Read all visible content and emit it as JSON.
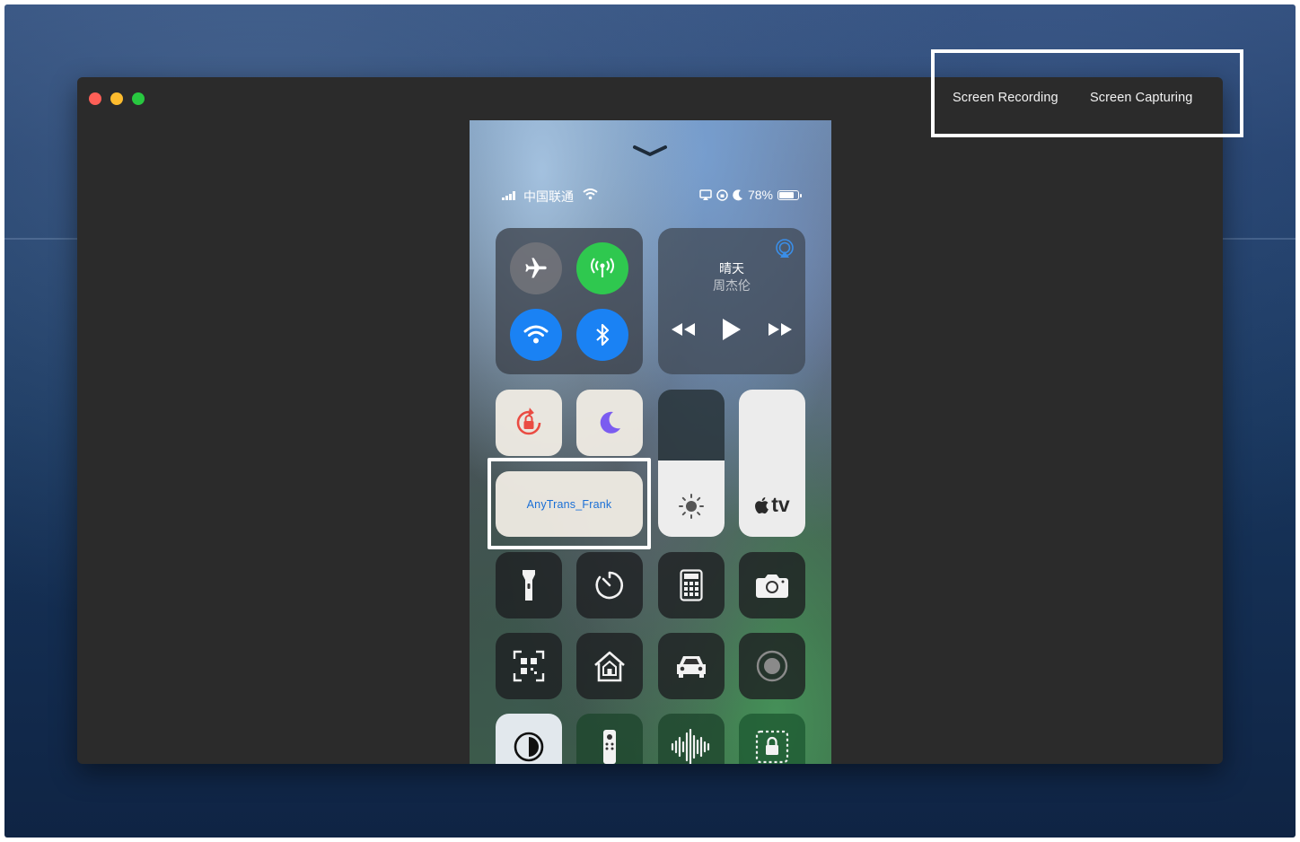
{
  "window": {
    "controls": [
      "close",
      "minimize",
      "maximize"
    ]
  },
  "mode_tabs": {
    "recording": "Screen Recording",
    "capturing": "Screen Capturing"
  },
  "phone": {
    "status": {
      "carrier": "中国联通",
      "battery": "78%"
    },
    "music": {
      "title": "晴天",
      "artist": "周杰伦"
    },
    "screen_mirroring": {
      "label": "AnyTrans_Frank"
    },
    "apple_tv": {
      "label": "tv"
    },
    "brightness_level": 0.52,
    "colors": {
      "green": "#2fc84f",
      "blue": "#1a82f4",
      "mirror_text": "#1a6fd6"
    },
    "icons": [
      "chevron-down-icon",
      "signal-icon",
      "wifi-status-icon",
      "airplay-status-icon",
      "lock-rotation-status-icon",
      "moon-status-icon",
      "airplane-icon",
      "cellular-icon",
      "wifi-icon",
      "bluetooth-icon",
      "airplay-icon",
      "rewind-icon",
      "play-icon",
      "fast-forward-icon",
      "rotation-lock-icon",
      "do-not-disturb-icon",
      "sun-icon",
      "apple-icon",
      "flashlight-icon",
      "timer-icon",
      "calculator-icon",
      "camera-icon",
      "qr-code-icon",
      "home-icon",
      "car-icon",
      "screen-record-icon",
      "dark-mode-icon",
      "remote-icon",
      "voice-memo-icon",
      "guided-access-icon"
    ]
  }
}
